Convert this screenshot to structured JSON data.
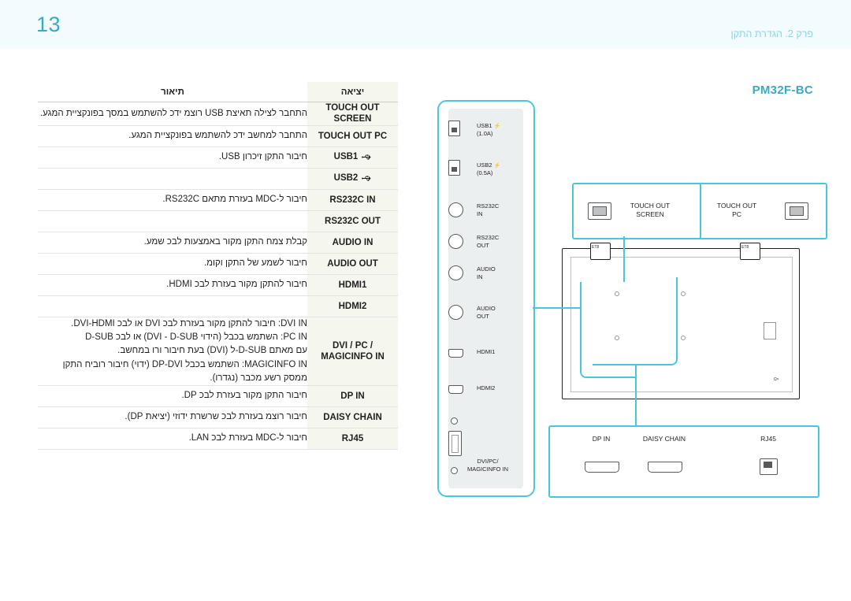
{
  "header": {
    "page_number": "13",
    "chapter": "פרק 2. הגדרת התקן"
  },
  "model": {
    "label": "PM32F-BC"
  },
  "table": {
    "headers": {
      "port": "יציאה",
      "description": "תיאור"
    },
    "rows": [
      {
        "port": "TOUCH OUT SCREEN",
        "desc": "התחבר לצילה תאיצת USB רוצמ ידכ להשתמש במסך בפונקציית המגע."
      },
      {
        "port": "TOUCH OUT PC",
        "desc": "התחבר למחשב ידכ להשתמש בפונקציית המגע."
      },
      {
        "port": "USB1",
        "desc": "חיבור התקן זיכרון USB.",
        "icon": "usb-icon"
      },
      {
        "port": "USB2",
        "desc": "",
        "icon": "usb-icon"
      },
      {
        "port": "RS232C IN",
        "desc": "חיבור ל-MDC בעזרת מתאם RS232C."
      },
      {
        "port": "RS232C OUT",
        "desc": ""
      },
      {
        "port": "AUDIO IN",
        "desc": "קבלת צמח התקן מקור באמצעות לבכ שמע."
      },
      {
        "port": "AUDIO OUT",
        "desc": "חיבור לשמע של התקן וקומ."
      },
      {
        "port": "HDMI1",
        "desc": "חיבור להתקן מקור בעזרת לבכ HDMI."
      },
      {
        "port": "HDMI2",
        "desc": ""
      },
      {
        "port": "DVI / PC / MAGICINFO IN",
        "desc": "DVI IN: חיבור להתקן מקור בעזרת לבכ DVI או לבכ DVI-HDMI.\nPC IN: השתמש בכבל (הידוי DVI - D-SUB) או לבכ D-SUB\nעם מאתם D-SUB-ל (DVI) בעת חיבור ורו במחשב.\nMAGICINFO IN: השתמש בכבל DP-DVI (ידוי) חיבור רוביח התקן\nממסק רשע מכבר (נגדרו)."
      },
      {
        "port": "DP IN",
        "desc": "חיבור התקן מקור בעזרת לבכ DP."
      },
      {
        "port": "DAISY CHAIN",
        "desc": "חיבור רוצמ בעזרת לבכ שרשרת ידוזי (יציאת DP)."
      },
      {
        "port": "RJ45",
        "desc": "חיבור ל-MDC בעזרת לבכ LAN."
      }
    ]
  },
  "diagram": {
    "strip_ports": [
      {
        "name": "USB1",
        "sub": "(1.0A)",
        "icon": "usb-icon"
      },
      {
        "name": "USB2",
        "sub": "(0.5A)",
        "icon": "usb-icon"
      },
      {
        "name": "RS232C\nIN",
        "sub": ""
      },
      {
        "name": "RS232C\nOUT",
        "sub": ""
      },
      {
        "name": "AUDIO\nIN",
        "sub": ""
      },
      {
        "name": "AUDIO\nOUT",
        "sub": ""
      },
      {
        "name": "HDMI1",
        "sub": ""
      },
      {
        "name": "HDMI2",
        "sub": ""
      },
      {
        "name": "DVI/PC/\nMAGICINFO IN",
        "sub": ""
      }
    ],
    "touch_callouts": [
      {
        "label": "TOUCH OUT\nSCREEN"
      },
      {
        "label": "TOUCH OUT\nPC"
      }
    ],
    "bottom_callouts": [
      {
        "label": "DP IN"
      },
      {
        "label": "DAISY CHAIN"
      },
      {
        "label": "RJ45"
      }
    ]
  },
  "colors": {
    "accent": "#49c7e0",
    "header_bg": "#f2fbfd",
    "port_cell_bg": "#f5f6ee",
    "text": "#231f20"
  }
}
